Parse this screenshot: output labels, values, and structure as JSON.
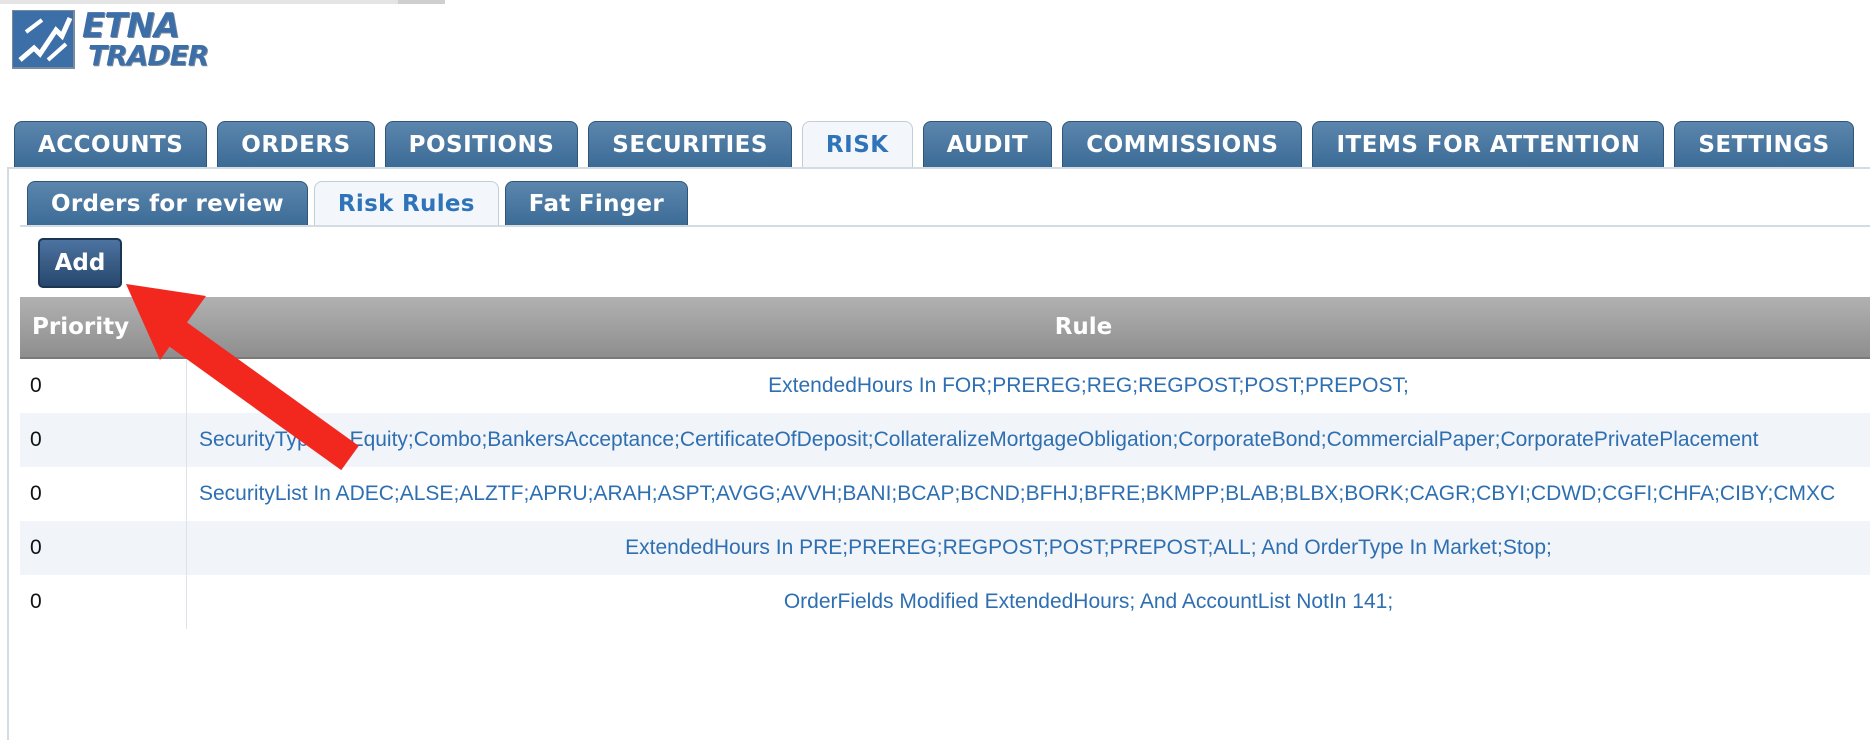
{
  "logo": {
    "line1": "ETNA",
    "line2": "TRADER",
    "color": "#3c6ea8"
  },
  "main_tabs": [
    {
      "label": "ACCOUNTS",
      "active": false
    },
    {
      "label": "ORDERS",
      "active": false
    },
    {
      "label": "POSITIONS",
      "active": false
    },
    {
      "label": "SECURITIES",
      "active": false
    },
    {
      "label": "RISK",
      "active": true
    },
    {
      "label": "AUDIT",
      "active": false
    },
    {
      "label": "COMMISSIONS",
      "active": false
    },
    {
      "label": "ITEMS FOR ATTENTION",
      "active": false
    },
    {
      "label": "SETTINGS",
      "active": false
    }
  ],
  "sub_tabs": [
    {
      "label": "Orders for review",
      "active": false
    },
    {
      "label": "Risk Rules",
      "active": true
    },
    {
      "label": "Fat Finger",
      "active": false
    }
  ],
  "toolbar": {
    "add_label": "Add"
  },
  "table": {
    "headers": {
      "priority": "Priority",
      "rule": "Rule"
    },
    "rows": [
      {
        "priority": "0",
        "rule": "ExtendedHours In FOR;PREREG;REG;REGPOST;POST;PREPOST;"
      },
      {
        "priority": "0",
        "rule": "SecurityType In Equity;Combo;BankersAcceptance;CertificateOfDeposit;CollateralizeMortgageObligation;CorporateBond;CommercialPaper;CorporatePrivatePlacement"
      },
      {
        "priority": "0",
        "rule": "SecurityList In ADEC;ALSE;ALZTF;APRU;ARAH;ASPT;AVGG;AVVH;BANI;BCAP;BCND;BFHJ;BFRE;BKMPP;BLAB;BLBX;BORK;CAGR;CBYI;CDWD;CGFI;CHFA;CIBY;CMXC"
      },
      {
        "priority": "0",
        "rule": "ExtendedHours In PRE;PREREG;REGPOST;POST;PREPOST;ALL; And OrderType In Market;Stop;"
      },
      {
        "priority": "0",
        "rule": "OrderFields Modified ExtendedHours; And AccountList NotIn 141;"
      }
    ]
  },
  "colors": {
    "tab_blue": "#3b6b96",
    "active_tab_text": "#2f74b8",
    "link_blue": "#2e6fb2",
    "arrow_red": "#f2281e"
  }
}
